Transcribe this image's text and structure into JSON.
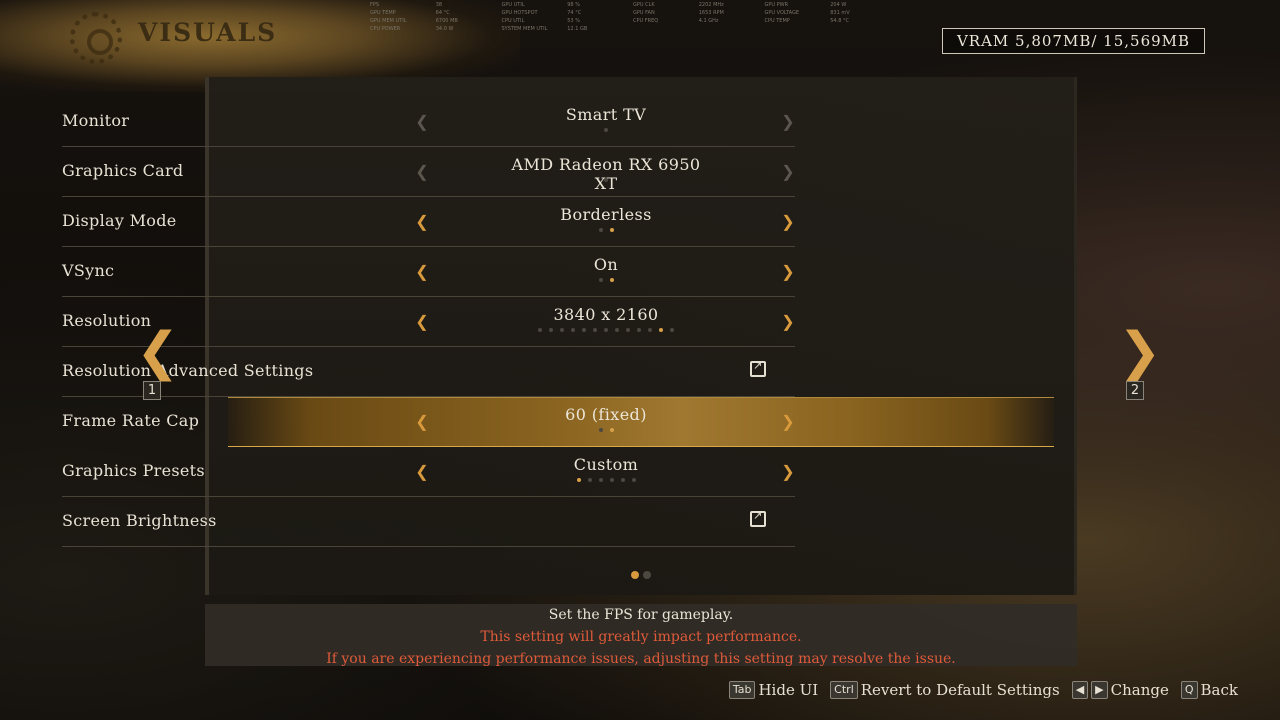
{
  "header": {
    "title": "VISUALS",
    "vram": "VRAM 5,807MB/ 15,569MB"
  },
  "perf_overlay": [
    "FPS",
    "38",
    "GPU UTIL",
    "98 %",
    "GPU CLK",
    "2202 MHz",
    "GPU PWR",
    "204 W",
    "GPU TEMP",
    "64 °C",
    "GPU HOTSPOT",
    "74 °C",
    "GPU FAN",
    "1653 RPM",
    "GPU VOLTAGE",
    "831 mV",
    "GPU MEM UTIL",
    "6700 MB",
    "CPU UTIL",
    "53 %",
    "CPU FREQ",
    "4.1 GHz",
    "CPU TEMP",
    "54.8 °C",
    "CPU POWER",
    "34.0 W",
    "SYSTEM MEM UTIL",
    "12.1 GB"
  ],
  "settings": [
    {
      "label": "Monitor",
      "value": "Smart TV",
      "dots": 1,
      "active_dot": 0,
      "enabled": false
    },
    {
      "label": "Graphics Card",
      "value": "AMD Radeon RX 6950 XT",
      "dots": 1,
      "active_dot": 0,
      "enabled": false
    },
    {
      "label": "Display Mode",
      "value": "Borderless",
      "dots": 2,
      "active_dot": 1,
      "enabled": true
    },
    {
      "label": "VSync",
      "value": "On",
      "dots": 2,
      "active_dot": 1,
      "enabled": true
    },
    {
      "label": "Resolution",
      "value": "3840 x 2160",
      "dots": 13,
      "active_dot": 11,
      "enabled": true
    },
    {
      "label": "Resolution Advanced Settings",
      "value": "",
      "link": true
    },
    {
      "label": "Frame Rate Cap",
      "value": "60 (fixed)",
      "dots": 2,
      "active_dot": 1,
      "enabled": true,
      "selected": true
    },
    {
      "label": "Graphics Presets",
      "value": "Custom",
      "dots": 6,
      "active_dot": 0,
      "enabled": true
    },
    {
      "label": "Screen Brightness",
      "value": "",
      "link": true
    }
  ],
  "page_indicator": {
    "pages": 2,
    "current": 1
  },
  "side_nav": {
    "prev_key": "1",
    "next_key": "2"
  },
  "description": {
    "line1": "Set the FPS for gameplay.",
    "warning1": "This setting will greatly impact performance.",
    "warning2": "If you are experiencing performance issues, adjusting this setting may resolve the issue."
  },
  "footer": {
    "tab_key": "Tab",
    "hide_ui": "Hide UI",
    "ctrl_key": "Ctrl",
    "revert": "Revert to Default Settings",
    "change": "Change",
    "q_key": "Q",
    "back": "Back"
  },
  "colors": {
    "accent": "#d89a3c",
    "warning": "#e05a3a"
  }
}
